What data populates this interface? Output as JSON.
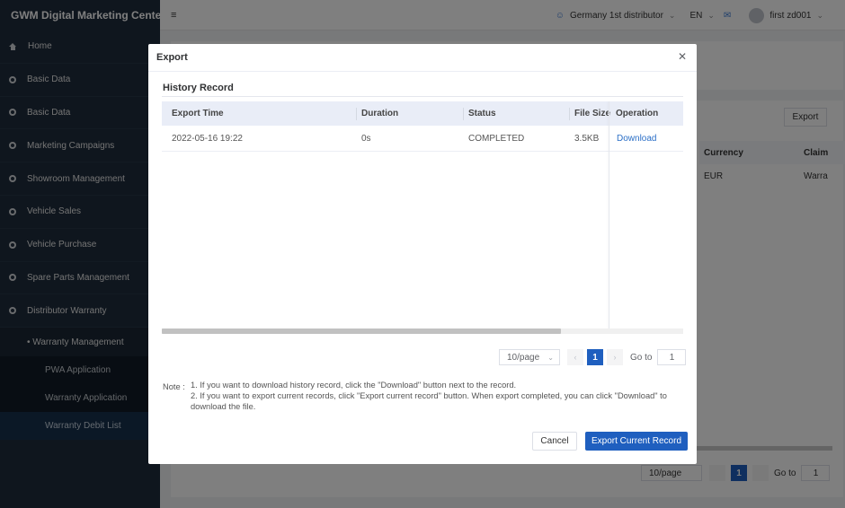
{
  "app": {
    "title": "GWM Digital Marketing Center"
  },
  "sidebar": {
    "items": [
      {
        "label": "Home",
        "icon": "home-icon"
      },
      {
        "label": "Basic Data"
      },
      {
        "label": "Basic Data"
      },
      {
        "label": "Marketing Campaigns"
      },
      {
        "label": "Showroom Management"
      },
      {
        "label": "Vehicle Sales"
      },
      {
        "label": "Vehicle Purchase"
      },
      {
        "label": "Spare Parts Management"
      },
      {
        "label": "Distributor Warranty"
      }
    ],
    "submenu": {
      "label": "Warranty Management",
      "items": [
        {
          "label": "PWA Application"
        },
        {
          "label": "Warranty Application"
        },
        {
          "label": "Warranty Debit List"
        }
      ]
    }
  },
  "header": {
    "distributor": "Germany 1st distributor",
    "language": "EN",
    "user": "first zd001"
  },
  "background": {
    "export_label": "Export",
    "columns": [
      "Currency",
      "Claim"
    ],
    "row": [
      "EUR",
      "Warra"
    ],
    "pager": {
      "size": "10/page",
      "page": "1",
      "goto_label": "Go to",
      "goto_value": "1"
    }
  },
  "modal": {
    "title": "Export",
    "section_title": "History Record",
    "columns": [
      "Export Time",
      "Duration",
      "Status",
      "File Size",
      "Operation"
    ],
    "rows": [
      {
        "export_time": "2022-05-16 19:22",
        "duration": "0s",
        "status": "COMPLETED",
        "file_size": "3.5KB",
        "operation": "Download"
      }
    ],
    "pager": {
      "size": "10/page",
      "page": "1",
      "goto_label": "Go to",
      "goto_value": "1"
    },
    "note": {
      "label": "Note :",
      "line1": "1. If you want to download history record, click the \"Download\" button next to the record.",
      "line2": "2. If you want to export current records, click \"Export current record\" button. When export completed, you can click \"Download\" to download the file."
    },
    "cancel_label": "Cancel",
    "export_label": "Export Current Record"
  },
  "colors": {
    "primary": "#1f5fbf",
    "sidebar": "#1f2d3d",
    "link": "#2b6fc7"
  }
}
